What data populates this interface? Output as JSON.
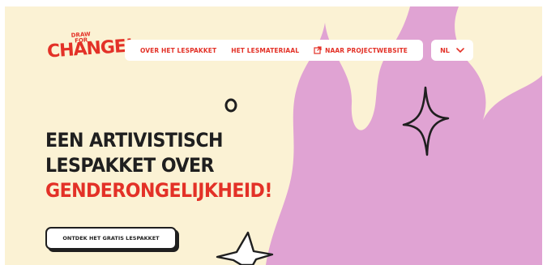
{
  "logo": {
    "main": "CHANGE!",
    "small_top": "DRAW",
    "small_bottom": "FOR"
  },
  "nav": {
    "items": [
      {
        "label": "OVER HET LESPAKKET"
      },
      {
        "label": "HET LESMATERIAAL"
      },
      {
        "label": "NAAR PROJECTWEBSITE",
        "icon": "external-link-icon"
      }
    ]
  },
  "language": {
    "selected": "NL",
    "icon": "chevron-down-icon"
  },
  "hero": {
    "line1": "EEN ARTIVISTISCH",
    "line2": "LESPAKKET OVER",
    "line3": "GENDERONGELIJKHEID!"
  },
  "cta": {
    "label": "ONTDEK HET GRATIS LESPAKKET"
  },
  "colors": {
    "background": "#fbf2d4",
    "accent": "#e33127",
    "flame": "#e0a3d3",
    "ink": "#1f1f1f"
  }
}
